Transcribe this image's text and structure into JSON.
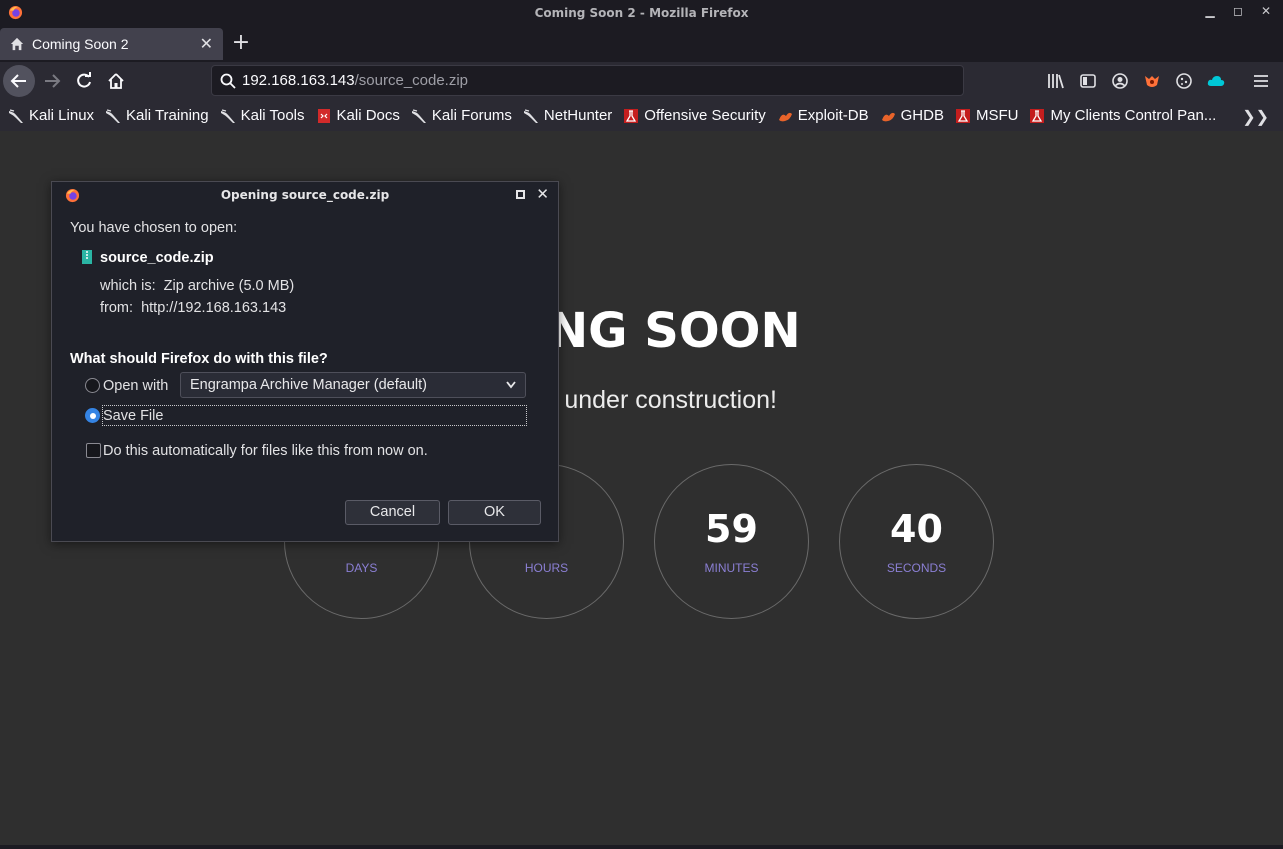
{
  "window": {
    "title": "Coming Soon 2 - Mozilla Firefox"
  },
  "tab": {
    "label": "Coming Soon 2"
  },
  "urlbar": {
    "host": "192.168.163.143",
    "path": "/source_code.zip"
  },
  "bookmarks": [
    {
      "label": "Kali Linux",
      "icon": "kali-dragon-icon"
    },
    {
      "label": "Kali Training",
      "icon": "kali-dragon-icon"
    },
    {
      "label": "Kali Tools",
      "icon": "kali-dragon-icon"
    },
    {
      "label": "Kali Docs",
      "icon": "kali-docs-icon"
    },
    {
      "label": "Kali Forums",
      "icon": "kali-dragon-icon"
    },
    {
      "label": "NetHunter",
      "icon": "kali-dragon-icon"
    },
    {
      "label": "Offensive Security",
      "icon": "offsec-icon"
    },
    {
      "label": "Exploit-DB",
      "icon": "exploitdb-icon"
    },
    {
      "label": "GHDB",
      "icon": "exploitdb-icon"
    },
    {
      "label": "MSFU",
      "icon": "offsec-icon"
    },
    {
      "label": "My Clients Control Pan...",
      "icon": "offsec-icon"
    }
  ],
  "page": {
    "heading": "MING SOON",
    "subheading": "ite is under construction!",
    "countdown": [
      {
        "value": "",
        "unit": "DAYS"
      },
      {
        "value": "",
        "unit": "HOURS"
      },
      {
        "value": "59",
        "unit": "MINUTES"
      },
      {
        "value": "40",
        "unit": "SECONDS"
      }
    ]
  },
  "dialog": {
    "title": "Opening source_code.zip",
    "intro": "You have chosen to open:",
    "filename": "source_code.zip",
    "which_is_label": "which is:",
    "which_is_value": "Zip archive (5.0 MB)",
    "from_label": "from:",
    "from_value": "http://192.168.163.143",
    "question": "What should Firefox do with this file?",
    "open_with_label": "Open with",
    "open_with_app": "Engrampa Archive Manager (default)",
    "save_file_label": "Save File",
    "auto_label": "Do this automatically for files like this from now on.",
    "cancel_label": "Cancel",
    "ok_label": "OK",
    "selected_option": "save_file"
  }
}
